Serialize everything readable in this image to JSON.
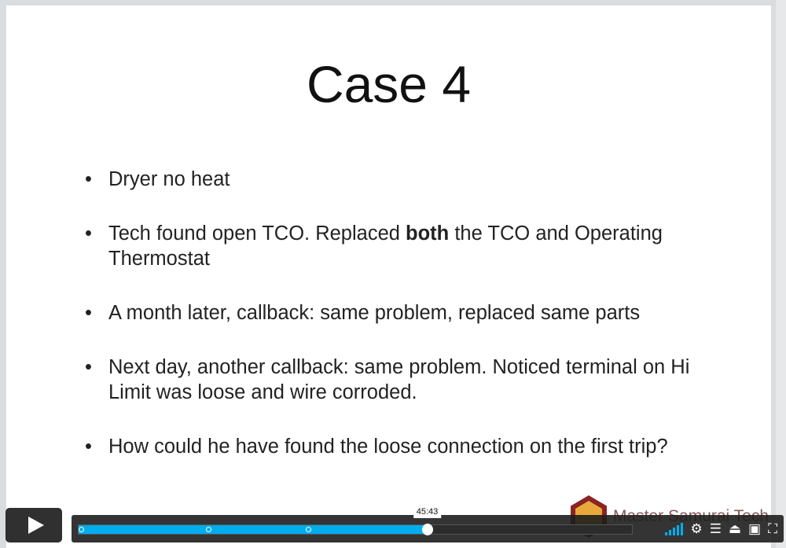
{
  "slide": {
    "title": "Case 4",
    "bullets": [
      {
        "pre": "Dryer no heat",
        "bold": "",
        "post": ""
      },
      {
        "pre": "Tech found open TCO. Replaced ",
        "bold": "both",
        "post": " the TCO and Operating Thermostat"
      },
      {
        "pre": "A month later, callback: same problem, replaced same parts",
        "bold": "",
        "post": ""
      },
      {
        "pre": "Next day, another callback: same problem. Noticed terminal on Hi Limit was loose and wire corroded.",
        "bold": "",
        "post": ""
      },
      {
        "pre": "How could he have found the loose connection on the first trip?",
        "bold": "",
        "post": ""
      }
    ],
    "logo_text": "Master Samurai Tech"
  },
  "player": {
    "time_tooltip": "45:43",
    "progress_fraction": 0.63,
    "chapter_fractions": [
      0,
      0.23,
      0.41
    ],
    "accent": "#00adef",
    "icons": [
      "volume-icon",
      "settings-icon",
      "chapters-icon",
      "airplay-icon",
      "pip-icon",
      "fullscreen-icon"
    ]
  }
}
